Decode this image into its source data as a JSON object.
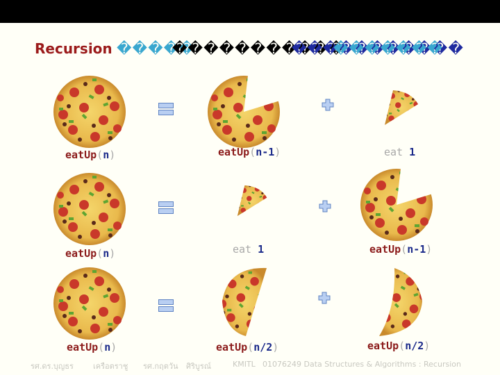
{
  "slide": {
    "title_prefix": "Recursion",
    "title_garbled": [
      "�����",
      "�����������",
      "�����������",
      "�������"
    ]
  },
  "rows": [
    {
      "lhs": {
        "fn": "eatUp",
        "open": "(",
        "arg": "n",
        "close": ")"
      },
      "op1": "equals-icon",
      "term1": {
        "kind": "call",
        "fn": "eatUp",
        "open": "(",
        "arg": "n-1",
        "close": ")"
      },
      "op2": "plus-icon",
      "term2": {
        "kind": "eat",
        "kw": "eat",
        "arg": "1"
      }
    },
    {
      "lhs": {
        "fn": "eatUp",
        "open": "(",
        "arg": "n",
        "close": ")"
      },
      "op1": "equals-icon",
      "term1": {
        "kind": "eat",
        "kw": "eat",
        "arg": "1"
      },
      "op2": "plus-icon",
      "term2": {
        "kind": "call",
        "fn": "eatUp",
        "open": "(",
        "arg": "n-1",
        "close": ")"
      }
    },
    {
      "lhs": {
        "fn": "eatUp",
        "open": "(",
        "arg": "n",
        "close": ")"
      },
      "op1": "equals-icon",
      "term1": {
        "kind": "call",
        "fn": "eatUp",
        "open": "(",
        "arg": "n/2",
        "close": ")"
      },
      "op2": "plus-icon",
      "term2": {
        "kind": "call",
        "fn": "eatUp",
        "open": "(",
        "arg": "n/2",
        "close": ")"
      }
    }
  ],
  "footer": {
    "author1": "รศ.ดร.บุญธร",
    "author1_last": "เครือตราชู",
    "author2": "รศ.กฤตวัน",
    "author2_last": "ศิริบูรณ์",
    "institution": "KMITL",
    "course": "01076249 Data Structures & Algorithms : Recursion"
  },
  "colors": {
    "function_name": "#8b1a1a",
    "argument": "#1b2a8a",
    "paren": "#a8a8a8",
    "title": "#9b1b1b",
    "icon_fill": "#b9cff2",
    "icon_stroke": "#5f83c2"
  }
}
